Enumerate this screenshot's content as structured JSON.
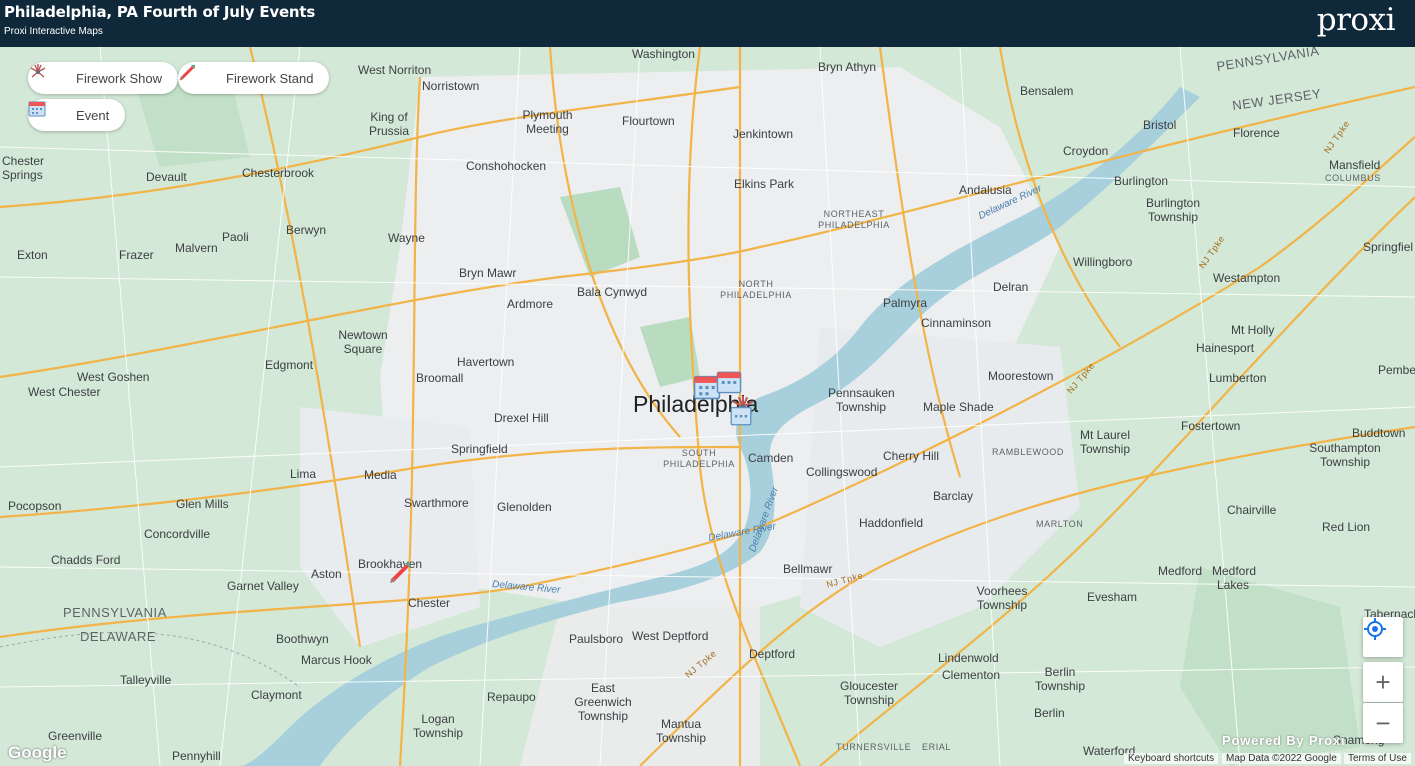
{
  "header": {
    "title": "Philadelphia, PA Fourth of July Events",
    "subtitle": "Proxi Interactive Maps",
    "logo": "proxi"
  },
  "legend": [
    {
      "label": "Firework Show",
      "icon": "firework-icon"
    },
    {
      "label": "Firework Stand",
      "icon": "rocket-icon"
    },
    {
      "label": "Event",
      "icon": "calendar-icon"
    }
  ],
  "map": {
    "places": {
      "philadelphia": "Philadelphia",
      "washington": "Washington",
      "bryn_athyn": "Bryn Athyn",
      "bensalem": "Bensalem",
      "west_norriton": "West Norriton",
      "norristown": "Norristown",
      "king_of_prussia": "King of Prussia",
      "plymouth_meeting": "Plymouth Meeting",
      "flourtown": "Flourtown",
      "jenkintown": "Jenkintown",
      "bristol": "Bristol",
      "florence": "Florence",
      "croydon": "Croydon",
      "mansfield": "Mansfield",
      "columbus": "COLUMBUS",
      "chester_springs": "Chester Springs",
      "devault": "Devault",
      "chesterbrook": "Chesterbrook",
      "conshohocken": "Conshohocken",
      "elkins_park": "Elkins Park",
      "andalusia": "Andalusia",
      "burlington": "Burlington",
      "burlington_township": "Burlington Township",
      "exton": "Exton",
      "frazer": "Frazer",
      "malvern": "Malvern",
      "paoli": "Paoli",
      "berwyn": "Berwyn",
      "wayne": "Wayne",
      "ne_philadelphia": "NORTHEAST PHILADELPHIA",
      "bryn_mawr": "Bryn Mawr",
      "ardmore": "Ardmore",
      "bala_cynwyd": "Bala Cynwyd",
      "n_philadelphia": "NORTH PHILADELPHIA",
      "palmyra": "Palmyra",
      "delran": "Delran",
      "willingboro": "Willingboro",
      "westampton": "Westampton",
      "springfield_nj": "Springfiel",
      "newtown_square": "Newtown Square",
      "havertown": "Havertown",
      "edgmont": "Edgmont",
      "broomall": "Broomall",
      "cinnaminson": "Cinnaminson",
      "mt_holly": "Mt Holly",
      "hainesport": "Hainesport",
      "west_goshen": "West Goshen",
      "west_chester": "West Chester",
      "drexel_hill": "Drexel Hill",
      "pennsauken": "Pennsauken Township",
      "maple_shade": "Maple Shade",
      "moorestown": "Moorestown",
      "lumberton": "Lumberton",
      "pemberton": "Pembe",
      "springfield": "Springfield",
      "s_philadelphia": "SOUTH PHILADELPHIA",
      "camden": "Camden",
      "collingswood": "Collingswood",
      "cherry_hill": "Cherry Hill",
      "ramblewood": "RAMBLEWOOD",
      "mt_laurel": "Mt Laurel Township",
      "fostertown": "Fostertown",
      "buddtown": "Buddtown",
      "southampton": "Southampton Township",
      "lima": "Lima",
      "media": "Media",
      "glen_mills": "Glen Mills",
      "pocopson": "Pocopson",
      "swarthmore": "Swarthmore",
      "glenolden": "Glenolden",
      "barclay": "Barclay",
      "haddonfield": "Haddonfield",
      "marlton": "MARLTON",
      "chairville": "Chairville",
      "red_lion": "Red Lion",
      "concordville": "Concordville",
      "chadds_ford": "Chadds Ford",
      "brookhaven": "Brookhaven",
      "aston": "Aston",
      "garnet_valley": "Garnet Valley",
      "chester": "Chester",
      "bellmawr": "Bellmawr",
      "medford": "Medford",
      "medford_lakes": "Medford Lakes",
      "voorhees": "Voorhees Township",
      "evesham": "Evesham",
      "tabernacle": "Tabernacle",
      "pennsylvania": "PENNSYLVANIA",
      "pennsylvania_ne": "PENNSYLVANIA",
      "new_jersey": "NEW JERSEY",
      "delaware": "DELAWARE",
      "boothwyn": "Boothwyn",
      "marcus_hook": "Marcus Hook",
      "paulsboro": "Paulsboro",
      "west_deptford": "West Deptford",
      "deptford": "Deptford",
      "talleyville": "Talleyville",
      "claymont": "Claymont",
      "repaupo": "Repaupo",
      "east_greenwich": "East Greenwich Township",
      "gloucester": "Gloucester Township",
      "lindenwold": "Lindenwold",
      "clementon": "Clementon",
      "berlin_twp": "Berlin Township",
      "berlin": "Berlin",
      "greenville": "Greenville",
      "logan": "Logan Township",
      "mantua": "Mantua Township",
      "pennyhill": "Pennyhill",
      "turnersville": "TURNERSVILLE",
      "erial": "ERIAL",
      "waterford": "Waterford",
      "shamong": "Shamong"
    },
    "rivers": {
      "delaware_ne": "Delaware River",
      "delaware_mid": "Delaware River",
      "delaware_sw": "Delaware River",
      "delaware_bottom": "Delaware River"
    },
    "roads": [
      "NJ Tpke",
      "NJ Tpke",
      "NJ Tpke",
      "NJ Tpke",
      "NJ Tpke"
    ]
  },
  "controls": {
    "locate_icon": "crosshair-icon",
    "zoom_in": "+",
    "zoom_out": "−"
  },
  "footer": {
    "google": "Google",
    "powered": "Powered By Proxi",
    "shortcuts": "Keyboard shortcuts",
    "map_data": "Map Data ©2022 Google",
    "terms": "Terms of Use"
  }
}
